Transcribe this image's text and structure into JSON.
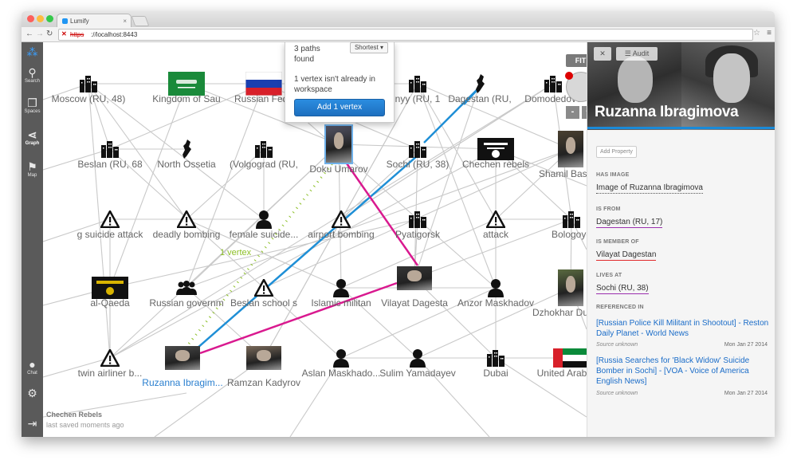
{
  "browser": {
    "tab_title": "Lumify",
    "url_protocol": "https",
    "url_host": "://localhost:8443"
  },
  "nav": {
    "items": [
      {
        "name": "Search"
      },
      {
        "name": "Spaces"
      },
      {
        "name": "Graph"
      },
      {
        "name": "Map"
      },
      {
        "name": "Chat"
      }
    ]
  },
  "popover": {
    "paths_found": "3 paths found",
    "sort": "Shortest",
    "notice": "1 vertex isn't already in workspace",
    "add_button": "Add 1 vertex"
  },
  "graph_controls": {
    "fit": "FIT",
    "zoom_out": "-",
    "zoom_in": "+"
  },
  "edge_label": "1 vertex",
  "nodes": [
    {
      "id": "moscow",
      "label": "Moscow (RU, 48)",
      "icon": "building"
    },
    {
      "id": "saudi",
      "label": "Kingdom of Sau",
      "icon": "saudi-flag"
    },
    {
      "id": "russia",
      "label": "Russian Fede",
      "icon": "russia-flag"
    },
    {
      "id": "grozny",
      "label": "nyy (RU, 1",
      "icon": "building"
    },
    {
      "id": "dagestan",
      "label": "Dagestan (RU,",
      "icon": "map-region"
    },
    {
      "id": "domodedovo",
      "label": "Domodedovo",
      "icon": "building"
    },
    {
      "id": "beslan",
      "label": "Beslan (RU, 68",
      "icon": "building"
    },
    {
      "id": "nossetia",
      "label": "North Ossetia",
      "icon": "map-region"
    },
    {
      "id": "volgograd",
      "label": "(Volgograd (RU,",
      "icon": "building"
    },
    {
      "id": "doku",
      "label": "Doku Umarov",
      "icon": "photo"
    },
    {
      "id": "sochi",
      "label": "Sochi (RU, 38)",
      "icon": "building"
    },
    {
      "id": "chechenrebels",
      "label": "Chechen rebels",
      "icon": "black-flag"
    },
    {
      "id": "shamil",
      "label": "Shamil Basaye",
      "icon": "photo"
    },
    {
      "id": "suicide",
      "label": "g suicide attack",
      "icon": "warning"
    },
    {
      "id": "deadly",
      "label": "deadly bombing",
      "icon": "warning"
    },
    {
      "id": "female",
      "label": "female suicide...",
      "icon": "person"
    },
    {
      "id": "airport",
      "label": "airport bombing",
      "icon": "warning"
    },
    {
      "id": "pyatigorsk",
      "label": "Pyatigorsk",
      "icon": "building"
    },
    {
      "id": "attack",
      "label": "attack",
      "icon": "warning"
    },
    {
      "id": "bologoye",
      "label": "Bologoye",
      "icon": "building"
    },
    {
      "id": "alqaeda",
      "label": "al-Qaeda",
      "icon": "flag-yellow"
    },
    {
      "id": "rusgov",
      "label": "Russian governm",
      "icon": "group"
    },
    {
      "id": "beslanschool",
      "label": "Beslan school s",
      "icon": "warning"
    },
    {
      "id": "islamic",
      "label": "Islamic militan",
      "icon": "person"
    },
    {
      "id": "vilayat",
      "label": "Vilayat Dagesta",
      "icon": "photo"
    },
    {
      "id": "anzor",
      "label": "Anzor Maskhadov",
      "icon": "person"
    },
    {
      "id": "dzhokhar",
      "label": "Dzhokhar Dudaye",
      "icon": "photo"
    },
    {
      "id": "twin",
      "label": "twin airliner b...",
      "icon": "warning"
    },
    {
      "id": "ruzanna",
      "label": "Ruzanna Ibragim...",
      "icon": "photo",
      "selected": true
    },
    {
      "id": "ramzan",
      "label": "Ramzan Kadyrov",
      "icon": "photo"
    },
    {
      "id": "aslan",
      "label": "Aslan Maskhado...",
      "icon": "person"
    },
    {
      "id": "sulim",
      "label": "Sulim Yamadayev",
      "icon": "person"
    },
    {
      "id": "dubai",
      "label": "Dubai",
      "icon": "building"
    },
    {
      "id": "uae",
      "label": "United Arab Emi",
      "icon": "uae-flag"
    }
  ],
  "workspace": {
    "name": "Chechen Rebels",
    "saved": "last saved moments ago"
  },
  "detail": {
    "title": "Ruzanna Ibragimova",
    "audit_button": "Audit",
    "add_property": "Add Property",
    "relations": [
      {
        "label": "HAS IMAGE",
        "value": "Image of Ruzanna Ibragimova",
        "color": "#555555"
      },
      {
        "label": "IS FROM",
        "value": "Dagestan (RU, 17)",
        "color": "#9b2fae"
      },
      {
        "label": "IS MEMBER OF",
        "value": "Vilayat Dagestan",
        "color": "#e0292b"
      },
      {
        "label": "LIVES AT",
        "value": "Sochi (RU, 38)",
        "color": "#9b2fae"
      }
    ],
    "referenced_in_label": "REFERENCED IN",
    "references": [
      {
        "title": "[Russian Police Kill Militant in Shootout] - Reston Daily Planet - World News",
        "source": "Source unknown",
        "date": "Mon Jan 27 2014"
      },
      {
        "title": "[Russia Searches for 'Black Widow' Suicide Bomber in Sochi] - [VOA - Voice of America English News]",
        "source": "Source unknown",
        "date": "Mon Jan 27 2014"
      }
    ]
  },
  "colors": {
    "accent": "#1a8ad8",
    "path_blue": "#1f8fd6",
    "path_pink": "#d9198f",
    "path_green": "#8cbf26",
    "nav_bg": "#5a5a5a"
  }
}
